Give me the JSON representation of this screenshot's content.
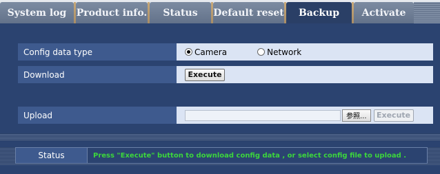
{
  "tabs": [
    {
      "label": "System log",
      "active": false
    },
    {
      "label": "Product info.",
      "active": false
    },
    {
      "label": "Status",
      "active": false
    },
    {
      "label": "Default reset",
      "active": false
    },
    {
      "label": "Backup",
      "active": true
    },
    {
      "label": "Activate",
      "active": false
    }
  ],
  "config": {
    "label": "Config data type",
    "options": [
      {
        "label": "Camera",
        "selected": true
      },
      {
        "label": "Network",
        "selected": false
      }
    ]
  },
  "download": {
    "label": "Download",
    "button": "Execute"
  },
  "upload": {
    "label": "Upload",
    "file_value": "",
    "browse_button": "参照...",
    "button": "Execute",
    "button_enabled": false
  },
  "status": {
    "label": "Status",
    "message": "Press \"Execute\" button to download config data , or select config file to upload ."
  },
  "colors": {
    "panel_bg": "#2b4370",
    "label_bg": "#3e5a8e",
    "value_bg": "#dbe4f4",
    "active_tab": "#2a3f66",
    "status_text": "#3cd63c"
  }
}
